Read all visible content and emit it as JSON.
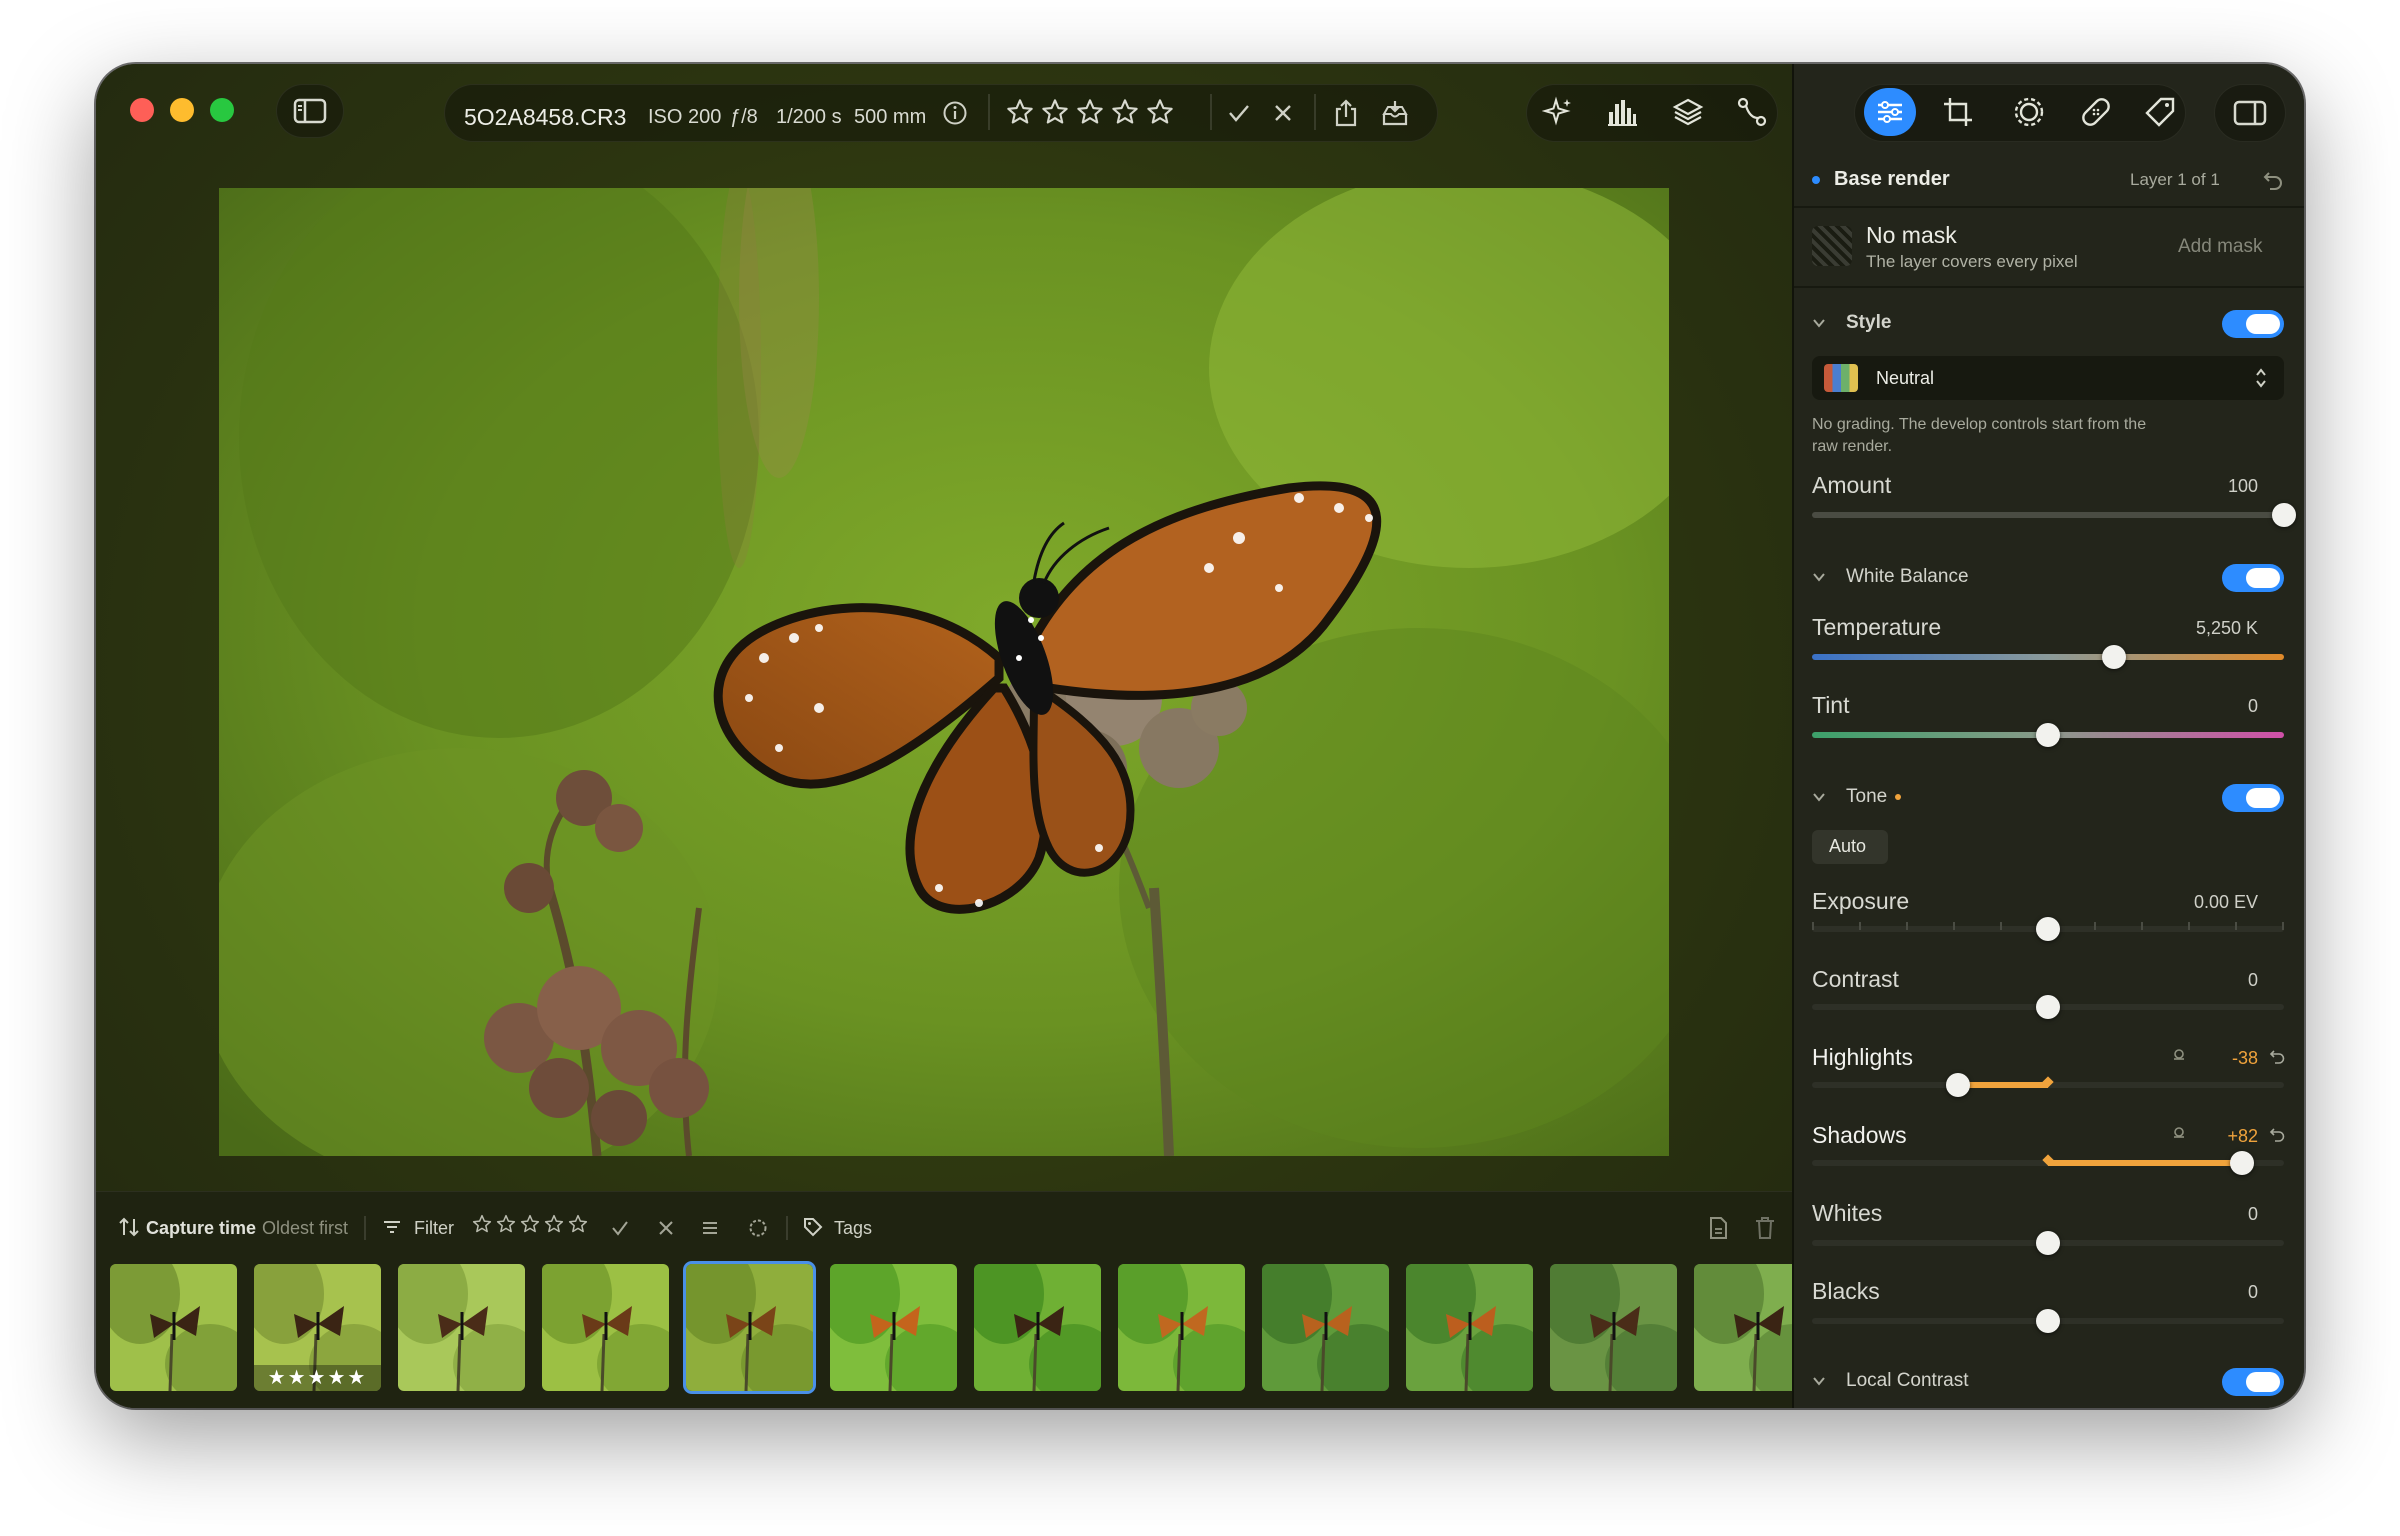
{
  "toolbar": {
    "filename": "5O2A8458.CR3",
    "iso": "ISO 200",
    "aperture": "ƒ/8",
    "shutter": "1/200 s",
    "focal": "500 mm",
    "left_icons": [
      "sidebar-toggle-icon"
    ],
    "center_icons": [
      "info-icon",
      "star-icon",
      "check-icon",
      "reject-x-icon",
      "share-icon",
      "export-icon"
    ],
    "tool_icons": [
      "sparkle-icon",
      "histogram-icon",
      "layers-icon",
      "path-icon"
    ],
    "right_icons": [
      "adjustments-icon",
      "crop-icon",
      "mask-icon",
      "healing-icon",
      "tag-icon",
      "inspector-toggle-icon"
    ],
    "accent": "#2d8cff"
  },
  "filmstrip": {
    "sort_label": "Capture time",
    "sort_order": "Oldest first",
    "filter_label": "Filter",
    "tags_label": "Tags",
    "thumbnails": [
      {
        "rating_label": "",
        "selected": false
      },
      {
        "rating_label": "★★★★★",
        "selected": false
      },
      {
        "rating_label": "",
        "selected": false
      },
      {
        "rating_label": "",
        "selected": false
      },
      {
        "rating_label": "",
        "selected": true
      },
      {
        "rating_label": "",
        "selected": false
      },
      {
        "rating_label": "",
        "selected": false
      },
      {
        "rating_label": "",
        "selected": false
      },
      {
        "rating_label": "",
        "selected": false
      },
      {
        "rating_label": "",
        "selected": false
      },
      {
        "rating_label": "",
        "selected": false
      },
      {
        "rating_label": "",
        "selected": false
      }
    ]
  },
  "panel": {
    "layer_name": "Base render",
    "layer_count": "Layer 1 of 1",
    "mask_title": "No mask",
    "mask_subtitle": "The layer covers every pixel",
    "add_mask": "Add mask",
    "style": {
      "title": "Style",
      "enabled": true,
      "preset": "Neutral",
      "description_line1": "No grading. The develop controls start from the",
      "description_line2": "raw render.",
      "amount_label": "Amount",
      "amount_value": "100",
      "amount_fraction": 1.0
    },
    "white_balance": {
      "title": "White Balance",
      "enabled": true,
      "temperature_label": "Temperature",
      "temperature_value": "5,250 K",
      "temperature_fraction": 0.64,
      "tint_label": "Tint",
      "tint_value": "0",
      "tint_fraction": 0.5
    },
    "tone": {
      "title": "Tone",
      "enabled": true,
      "auto_label": "Auto",
      "exposure_label": "Exposure",
      "exposure_value": "0.00 EV",
      "exposure_fraction": 0.5,
      "contrast_label": "Contrast",
      "contrast_value": "0",
      "contrast_fraction": 0.5,
      "highlights_label": "Highlights",
      "highlights_value": "-38",
      "highlights_fraction": 0.31,
      "shadows_label": "Shadows",
      "shadows_value": "+82",
      "shadows_fraction": 0.91,
      "whites_label": "Whites",
      "whites_value": "0",
      "whites_fraction": 0.5,
      "blacks_label": "Blacks",
      "blacks_value": "0",
      "blacks_fraction": 0.5,
      "modified_color": "#f0a33c"
    },
    "local_contrast": {
      "title": "Local Contrast",
      "enabled": true
    }
  }
}
